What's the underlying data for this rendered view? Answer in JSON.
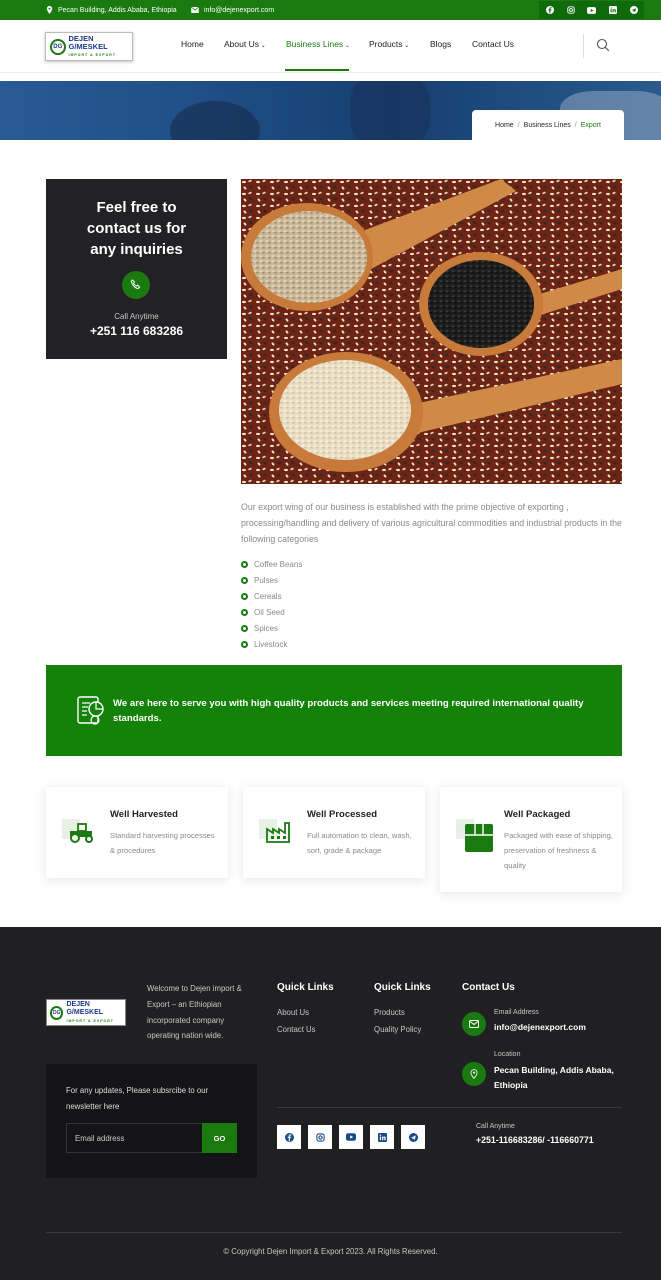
{
  "topbar": {
    "address": "Pecan Building, Addis Ababa, Ethiopia",
    "email": "info@dejenexport.com",
    "social": [
      "facebook-icon",
      "instagram-icon",
      "youtube-icon",
      "linkedin-icon",
      "telegram-icon"
    ]
  },
  "header": {
    "logo_text": "DEJEN G/MESKEL",
    "logo_sub": "IMPORT & EXPORT",
    "logo_mark": "DG",
    "nav": [
      {
        "label": "Home"
      },
      {
        "label": "About Us"
      },
      {
        "label": "Business Lines"
      },
      {
        "label": "Products"
      },
      {
        "label": "Blogs"
      },
      {
        "label": "Contact Us"
      }
    ],
    "active_nav": "Business Lines"
  },
  "breadcrumb": {
    "items": [
      "Home",
      "Business Lines",
      "Export"
    ]
  },
  "contact_card": {
    "title": "Feel free to contact us for any inquiries",
    "call_label": "Call Anytime",
    "phone": "+251 116 683286"
  },
  "main": {
    "description": "Our export wing of our business is established with the prime objective of exporting , processing/handling and delivery of various agricultural commodities and industrial products in the following categories",
    "categories": [
      "Coffee Beans",
      "Pulses",
      "Cereals",
      "Oil Seed",
      "Spices",
      "Livestock"
    ]
  },
  "banner": {
    "text": "We are here to serve you with high quality products and services meeting required international quality standards."
  },
  "features": [
    {
      "title": "Well Harvested",
      "text": "Standard harvesting processes & procedures",
      "icon": "tractor-icon"
    },
    {
      "title": "Well Processed",
      "text": "Full automation to clean, wash, sort, grade & package",
      "icon": "factory-icon"
    },
    {
      "title": "Well Packaged",
      "text": "Packaged with ease of shipping, preservation of freshness & quality",
      "icon": "package-icon"
    }
  ],
  "footer": {
    "welcome": "Welcome to Dejen import & Export – an Ethiopian incorporated company operating nation wide.",
    "quick_links_1": {
      "title": "Quick Links",
      "links": [
        "About Us",
        "Contact Us"
      ]
    },
    "quick_links_2": {
      "title": "Quick Links",
      "links": [
        "Products",
        "Quality Policy"
      ]
    },
    "contact": {
      "title": "Contact Us",
      "email_label": "Email Address",
      "email": "info@dejenexport.com",
      "location_label": "Location",
      "location": "Pecan Building, Addis Ababa, Ethiopia",
      "call_label": "Call Anytime",
      "phones": "+251-116683286/ -116660771"
    },
    "newsletter": {
      "text": "For any updates, Please subsrcibe to our newsletter here",
      "placeholder": "Email address",
      "button": "GO"
    },
    "social": [
      "facebook-icon",
      "instagram-icon",
      "youtube-icon",
      "linkedin-icon",
      "telegram-icon"
    ],
    "copyright": "© Copyright Dejen Import & Export 2023. All Rights Reserved."
  },
  "colors": {
    "brand_green": "#1a7a10",
    "dark": "#202022",
    "card_dark": "#222225"
  }
}
